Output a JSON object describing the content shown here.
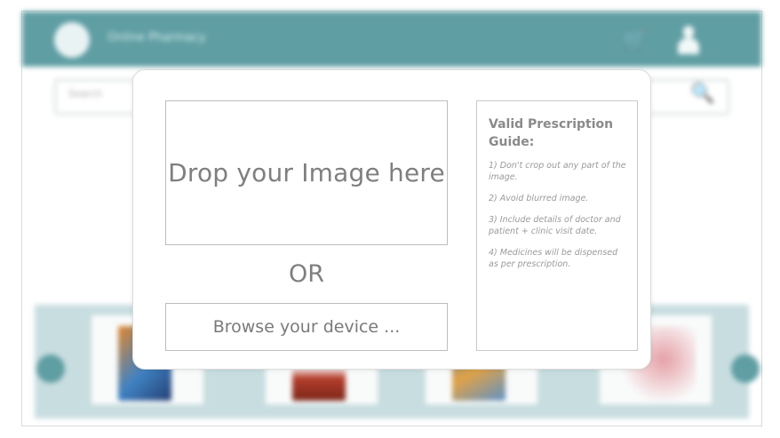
{
  "background": {
    "app_title": "Online Pharmacy",
    "search_placeholder": "Search",
    "icons": {
      "cart": "cart-icon",
      "user": "user-icon",
      "search": "search-icon",
      "prev": "chevron-left-icon",
      "next": "chevron-right-icon"
    },
    "brand_color": "#5f9ea3"
  },
  "modal": {
    "dropzone_label": "Drop your Image here",
    "or_label": "OR",
    "browse_label": "Browse your device ...",
    "guide": {
      "title": "Valid Prescription Guide:",
      "items": [
        "1) Don't crop out any part of the image.",
        "2) Avoid blurred image.",
        "3) Include details of doctor and patient + clinic visit date.",
        "4) Medicines will be dispensed as per prescription."
      ]
    }
  }
}
